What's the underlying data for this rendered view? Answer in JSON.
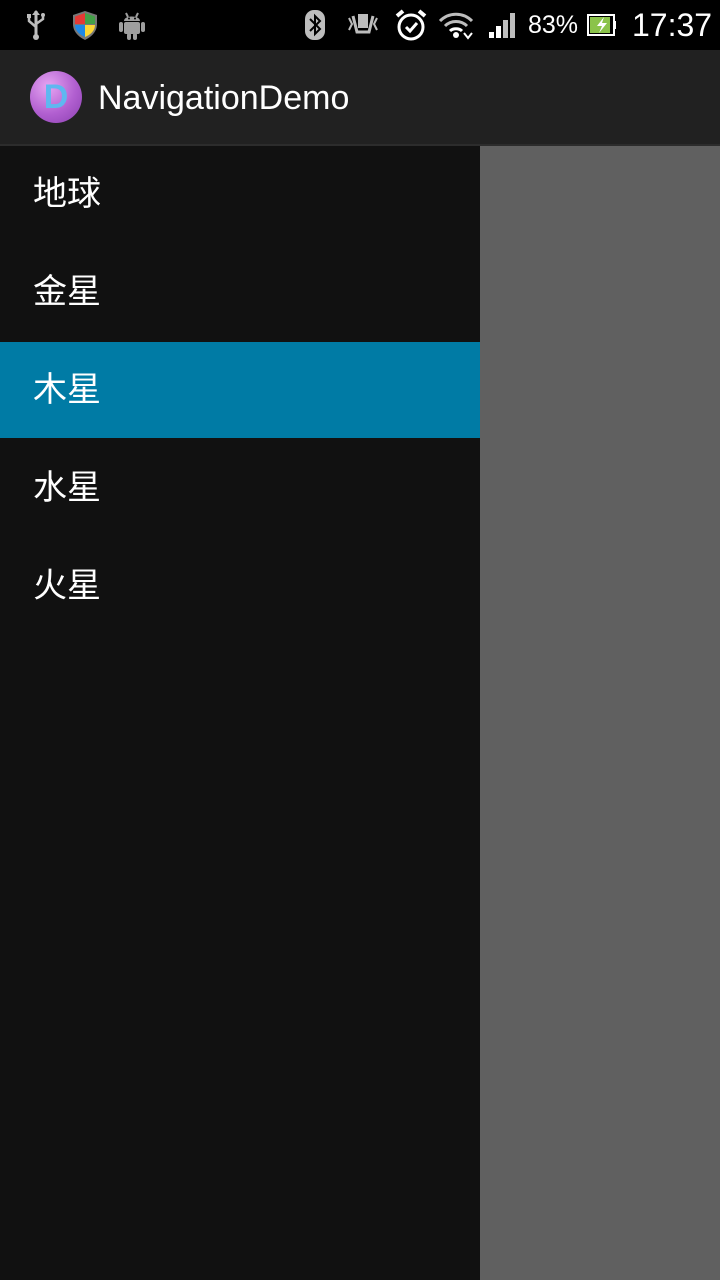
{
  "status_bar": {
    "icons_left": [
      "usb-icon",
      "shield-icon",
      "android-icon"
    ],
    "icons_right": [
      "bluetooth-icon",
      "vibrate-icon",
      "alarm-icon",
      "wifi-icon",
      "signal-icon"
    ],
    "battery_percent": "83%",
    "time": "17:37"
  },
  "action_bar": {
    "app_icon_letter": "D",
    "title": "NavigationDemo"
  },
  "drawer": {
    "items": [
      {
        "label": "地球"
      },
      {
        "label": "金星"
      },
      {
        "label": "木星"
      },
      {
        "label": "水星"
      },
      {
        "label": "火星"
      }
    ],
    "selected_index": 2
  },
  "colors": {
    "selected_item": "#007ba5",
    "drawer_background": "#111111",
    "action_bar": "#212121",
    "content_scrim": "#606060"
  }
}
